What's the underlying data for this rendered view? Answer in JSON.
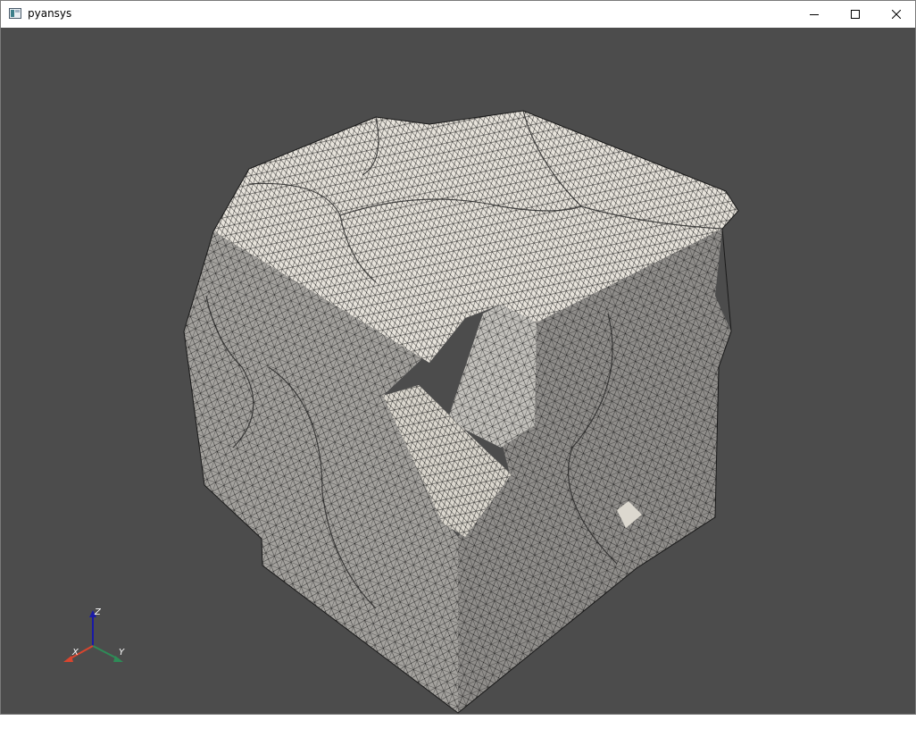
{
  "window": {
    "title": "pyansys",
    "icon": "app-window-icon",
    "controls": {
      "minimize": "minimize-icon",
      "maximize": "maximize-icon",
      "close": "close-icon"
    }
  },
  "viewport": {
    "background": "#4c4c4c",
    "mesh_face_color": "#e8e4dc",
    "mesh_shadow_color": "#9c9a96",
    "mesh_edge_color": "#1a1a1a"
  },
  "axes": {
    "x_label": "X",
    "y_label": "Y",
    "z_label": "Z",
    "x_color": "#d9452e",
    "y_color": "#2e8b57",
    "z_color": "#1a1aa6"
  }
}
